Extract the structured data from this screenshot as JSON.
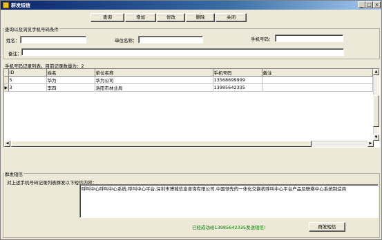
{
  "window": {
    "title": "群发短信",
    "controls": [
      "_",
      "□",
      "×"
    ]
  },
  "toolbar": {
    "buttons": [
      "查询",
      "增加",
      "修改",
      "删除",
      "关闭"
    ]
  },
  "query": {
    "group_title": "查询以及浏览手机号码条件",
    "name_label": "姓名：",
    "unit_label": "单位名称：",
    "phone_label": "手机号码：",
    "remark_label": "备注：",
    "name_value": "",
    "unit_value": "",
    "phone_value": "",
    "remark_value": ""
  },
  "list": {
    "group_title": "手机号码记录列表。目前记录数量为：2",
    "columns": [
      "ID",
      "姓名",
      "单位名称",
      "手机号码",
      "备注"
    ],
    "rows": [
      {
        "indicator": "",
        "id": "5",
        "name": "华为",
        "unit": "华为公司",
        "phone": "13568699999",
        "remark": ""
      },
      {
        "indicator": "▶",
        "id": "3",
        "name": "李四",
        "unit": "洛阳市林业局",
        "phone": "13985642335",
        "remark": ""
      }
    ]
  },
  "sms": {
    "group_title": "群发短信",
    "prompt": "对上述手机号码记录列表群发以下短信内容：",
    "content": "呼叫中心呼叫中心系统,呼叫中心平台,深圳市博城信息咨询有限公司,中国领先的一体化交换机呼叫中心平台产品及联络中心系统制造商",
    "status": "已经成功给13985642335发送短信!",
    "send_label": "群发短信"
  }
}
